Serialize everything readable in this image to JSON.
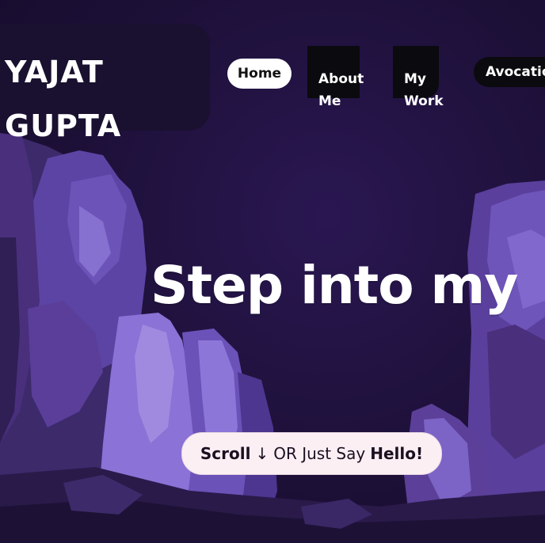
{
  "brand": {
    "line1": "YAJAT",
    "line2": "GUPTA"
  },
  "nav": {
    "home": "Home",
    "about": "About\nMe",
    "work": "My\nWork",
    "avocation": "Avocatio"
  },
  "hero": {
    "title": "Step into my"
  },
  "cta": {
    "scroll": "Scroll",
    "arrow": "↓",
    "middle": "OR Just Say",
    "hello": "Hello!"
  },
  "colors": {
    "background": "#1b0f33",
    "rock_light": "#7b62c8",
    "rock_mid": "#5a429e",
    "rock_dark": "#3a2766",
    "cta_bg": "#fbeff4"
  }
}
